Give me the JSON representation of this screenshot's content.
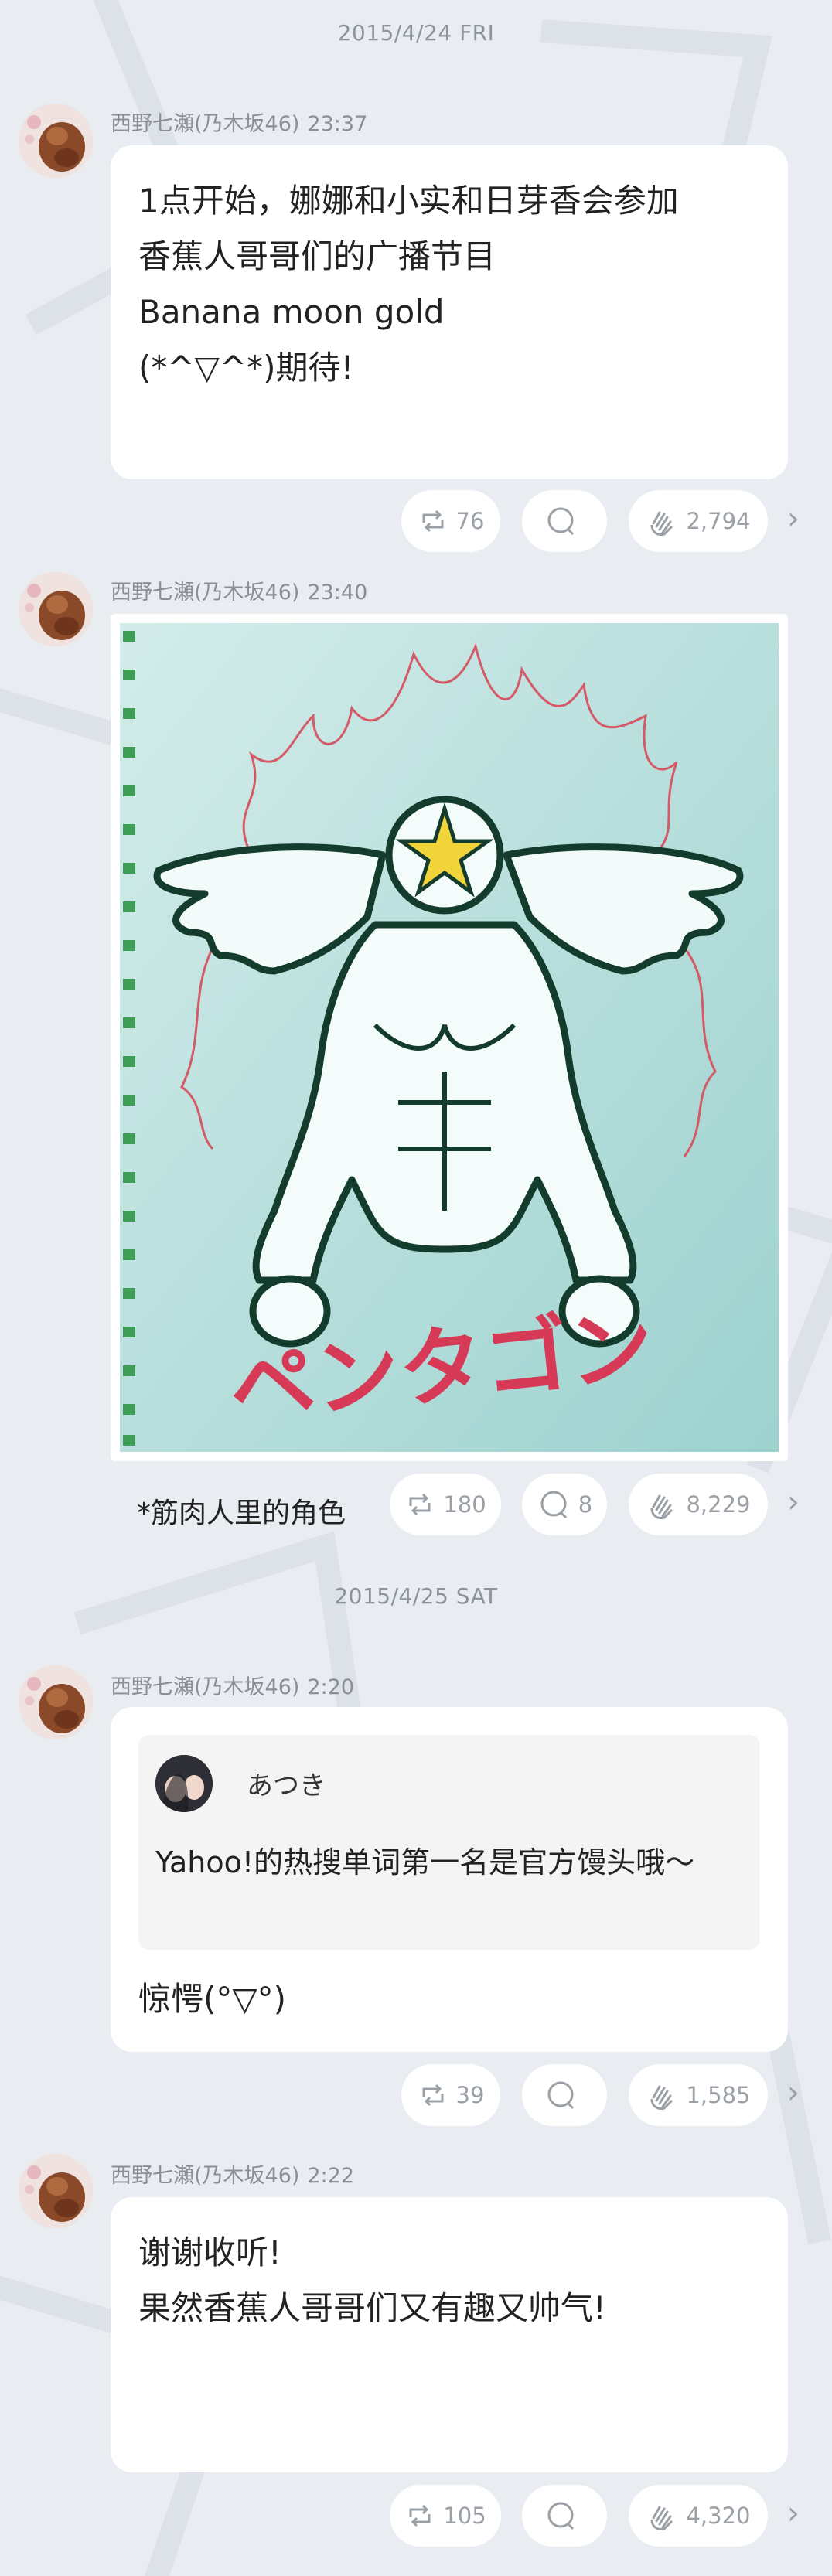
{
  "dates": [
    "2015/4/24 FRI",
    "2015/4/25 SAT"
  ],
  "author": {
    "name": "西野七瀬(乃木坂46)"
  },
  "posts": [
    {
      "time": "23:37",
      "text": "1点开始，娜娜和小实和日芽香会参加\n香蕉人哥哥们的广播节目\nBanana moon gold\n(*^▽^*)期待!",
      "repost_count": "76",
      "comment_count": "",
      "clap_count": "2,794"
    },
    {
      "time": "23:40",
      "image_title": "ペンタゴン",
      "caption": "*筋肉人里的角色",
      "repost_count": "180",
      "comment_count": "8",
      "clap_count": "8,229"
    },
    {
      "time": "2:20",
      "quote": {
        "name": "あつき",
        "text": "Yahoo!的热搜单词第一名是官方馒头哦〜"
      },
      "text": "惊愕(°▽°)",
      "repost_count": "39",
      "comment_count": "",
      "clap_count": "1,585"
    },
    {
      "time": "2:22",
      "text": "谢谢收听!\n果然香蕉人哥哥们又有趣又帅气!",
      "repost_count": "105",
      "comment_count": "",
      "clap_count": "4,320"
    }
  ],
  "icons": {
    "repost": "repost-icon",
    "comment": "comment-icon",
    "clap": "clap-icon",
    "more": "chevron-right-icon"
  },
  "colors": {
    "background": "#e9edf1",
    "card": "#ffffff",
    "muted": "#9aa0a6"
  }
}
